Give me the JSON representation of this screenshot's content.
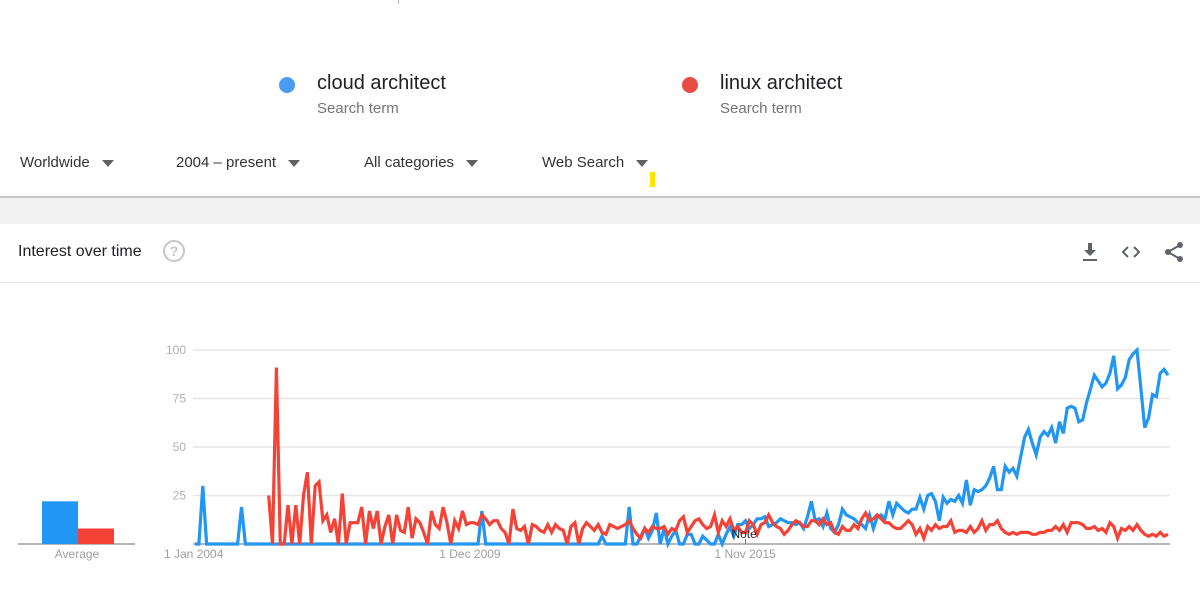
{
  "terms": [
    {
      "name": "cloud architect",
      "subtitle": "Search term",
      "color": "#4285f4"
    },
    {
      "name": "linux architect",
      "subtitle": "Search term",
      "color": "#ea4335"
    }
  ],
  "filters": {
    "region": "Worldwide",
    "time_range": "2004 – present",
    "category": "All categories",
    "search_type": "Web Search"
  },
  "card": {
    "title": "Interest over time",
    "help_icon": "?",
    "actions": [
      "download-icon",
      "embed-icon",
      "share-icon"
    ]
  },
  "chart_data": {
    "type": "line",
    "title": "Interest over time",
    "xlabel": "",
    "ylabel": "",
    "ylim": [
      0,
      100
    ],
    "yticks": [
      "100",
      "75",
      "50",
      "25"
    ],
    "xtick_labels": [
      "1 Jan 2004",
      "1 Dec 2009",
      "1 Nov 2015"
    ],
    "x_start": "Jan 2004",
    "x_step": "month",
    "annotation": "Note",
    "average": {
      "label": "Average",
      "values": [
        22,
        8
      ]
    },
    "series": [
      {
        "name": "cloud architect",
        "color": "#2196f3",
        "values": [
          0,
          0,
          30,
          0,
          0,
          0,
          0,
          0,
          0,
          0,
          0,
          0,
          19,
          0,
          0,
          0,
          0,
          0,
          0,
          0,
          0,
          0,
          0,
          0,
          0,
          0,
          0,
          0,
          0,
          0,
          0,
          0,
          0,
          0,
          0,
          0,
          0,
          0,
          0,
          0,
          0,
          0,
          0,
          0,
          0,
          0,
          0,
          0,
          0,
          0,
          0,
          0,
          0,
          0,
          0,
          0,
          0,
          0,
          0,
          0,
          0,
          0,
          0,
          0,
          0,
          0,
          0,
          0,
          0,
          0,
          0,
          0,
          0,
          0,
          17,
          0,
          0,
          0,
          0,
          0,
          0,
          0,
          0,
          0,
          0,
          0,
          0,
          0,
          0,
          0,
          0,
          0,
          0,
          0,
          0,
          0,
          0,
          0,
          0,
          0,
          0,
          0,
          0,
          0,
          0,
          4,
          0,
          0,
          0,
          0,
          0,
          0,
          19,
          0,
          0,
          4,
          8,
          3,
          7,
          16,
          0,
          8,
          0,
          4,
          7,
          0,
          0,
          5,
          5,
          0,
          0,
          4,
          2,
          0,
          0,
          5,
          0,
          5,
          9,
          4,
          10,
          10,
          12,
          8,
          10,
          13,
          13,
          14,
          9,
          10,
          11,
          13,
          12,
          11,
          11,
          10,
          11,
          8,
          14,
          22,
          12,
          13,
          9,
          16,
          8,
          6,
          10,
          18,
          15,
          14,
          13,
          11,
          10,
          8,
          15,
          8,
          14,
          15,
          13,
          22,
          15,
          21,
          19,
          17,
          16,
          18,
          18,
          24,
          18,
          25,
          26,
          22,
          12,
          24,
          21,
          23,
          22,
          25,
          21,
          33,
          20,
          28
        ],
        "tail": [
          27,
          28,
          30,
          34,
          40,
          28,
          28,
          40,
          37,
          39,
          35,
          45,
          55,
          59,
          52,
          46,
          55,
          58,
          56,
          60,
          52,
          63,
          57,
          70,
          71,
          70,
          63,
          64,
          73,
          80,
          87,
          84,
          81,
          83,
          88,
          97,
          80,
          82,
          86,
          95,
          98,
          100,
          80,
          60,
          65,
          77,
          76,
          88,
          90,
          87
        ]
      },
      {
        "name": "linux architect",
        "color": "#f44336",
        "values": [
          25,
          0,
          91,
          0,
          0,
          20,
          0,
          20,
          0,
          25,
          37,
          0,
          30,
          32,
          12,
          15,
          6,
          13,
          0,
          26,
          0,
          11,
          11,
          11,
          19,
          0,
          17,
          8,
          17,
          0,
          9,
          15,
          0,
          15,
          7,
          6,
          19,
          3,
          13,
          11,
          6,
          0,
          17,
          10,
          8,
          19,
          11,
          0,
          12,
          8,
          17,
          10,
          11,
          11,
          10,
          15,
          13,
          10,
          12,
          12,
          8,
          6,
          0,
          18,
          8,
          7,
          9,
          0,
          10,
          9,
          7,
          6,
          10,
          6,
          10,
          8,
          7,
          0,
          9,
          11,
          0,
          8,
          11,
          9,
          7,
          10,
          6,
          5,
          10,
          9,
          8,
          9,
          10,
          12,
          8,
          5,
          3,
          8,
          6,
          9,
          8,
          8,
          9,
          5,
          8,
          7,
          12,
          14,
          6,
          9,
          12,
          13,
          10,
          8,
          9,
          15,
          6,
          12,
          9,
          13,
          7,
          9,
          6,
          6,
          12,
          10,
          5,
          10,
          11,
          15,
          11,
          9,
          8,
          5,
          7,
          10,
          12,
          11,
          9,
          9,
          12,
          12,
          10,
          13,
          10,
          11,
          6,
          5,
          9,
          7,
          7,
          10,
          8,
          13,
          16,
          12,
          13,
          15,
          13,
          11,
          11,
          9,
          8,
          8,
          10,
          12,
          10,
          5,
          8,
          3,
          9,
          7,
          10,
          8,
          9,
          9,
          12,
          6,
          7,
          7,
          6,
          9,
          6,
          8,
          12,
          7,
          10,
          10,
          12,
          8,
          6,
          5,
          6,
          5,
          6,
          6,
          6,
          5,
          5,
          6,
          6,
          7,
          7,
          9,
          7,
          10,
          6,
          11,
          11,
          11,
          10,
          8,
          8,
          9,
          7,
          8,
          6,
          11,
          9,
          3,
          8,
          7,
          9,
          7,
          10,
          7,
          5,
          4,
          5,
          4,
          6,
          4,
          5
        ],
        "tail": []
      }
    ]
  }
}
